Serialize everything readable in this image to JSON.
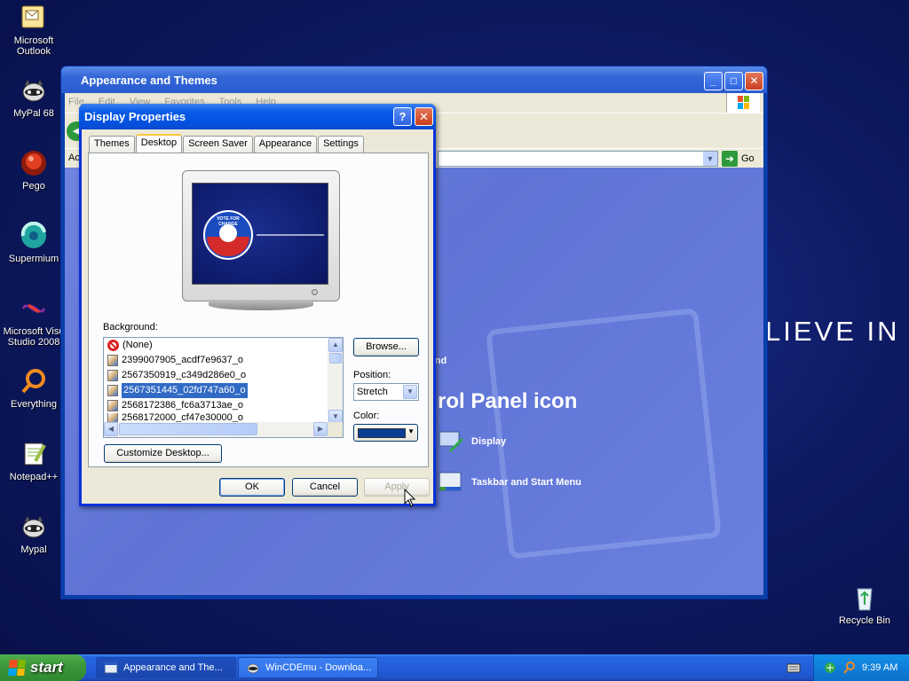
{
  "desktop": {
    "icons": [
      {
        "label": "Microsoft Outlook"
      },
      {
        "label": "MyPal 68"
      },
      {
        "label": "Pego"
      },
      {
        "label": "Supermium"
      },
      {
        "label": "Microsoft Visu Studio 2008"
      },
      {
        "label": "Everything"
      },
      {
        "label": "Notepad++"
      },
      {
        "label": "Mypal"
      },
      {
        "label": "Recycle Bin"
      }
    ],
    "wallpaper_text": "LIEVE IN"
  },
  "background_window": {
    "title": "Appearance and Themes",
    "menu": [
      "File",
      "Edit",
      "View",
      "Favorites",
      "Tools",
      "Help"
    ],
    "address_label": "Ac",
    "go_label": "Go",
    "content": {
      "snippet_1": "e",
      "snippet_2": "und",
      "heading": "rol Panel icon",
      "tasks": [
        {
          "label": "Display",
          "icon": "display-icon"
        },
        {
          "label": "Taskbar and Start Menu",
          "icon": "taskbar-icon"
        }
      ]
    }
  },
  "dialog": {
    "title": "Display Properties",
    "help": "?",
    "tabs": [
      "Themes",
      "Desktop",
      "Screen Saver",
      "Appearance",
      "Settings"
    ],
    "active_tab": "Desktop",
    "preview_text": "VOTE FOR CHANGE",
    "background_label": "Background:",
    "backgrounds": [
      {
        "name": "(None)",
        "type": "none"
      },
      {
        "name": "2399007905_acdf7e9637_o",
        "type": "file"
      },
      {
        "name": "2567350919_c349d286e0_o",
        "type": "file"
      },
      {
        "name": "2567351445_02fd747a60_o",
        "type": "file",
        "selected": true
      },
      {
        "name": "2568172386_fc6a3713ae_o",
        "type": "file"
      },
      {
        "name": "2568172000_cf47e30000_o",
        "type": "file"
      }
    ],
    "browse_label": "Browse...",
    "position_label": "Position:",
    "position_value": "Stretch",
    "color_label": "Color:",
    "color_value": "#0a3d94",
    "customize_label": "Customize Desktop...",
    "ok_label": "OK",
    "cancel_label": "Cancel",
    "apply_label": "Apply"
  },
  "taskbar": {
    "start_label": "start",
    "tasks": [
      {
        "label": "Appearance and The..."
      },
      {
        "label": "WinCDEmu - Downloa..."
      }
    ],
    "clock": "9:39 AM"
  }
}
